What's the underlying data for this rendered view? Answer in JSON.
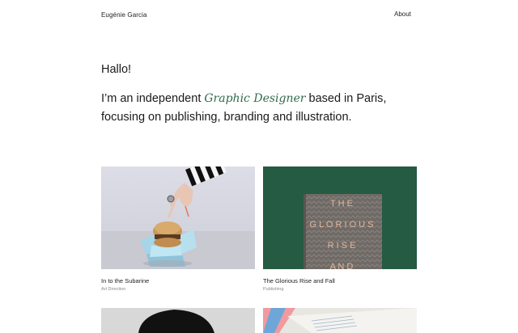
{
  "header": {
    "brand": "Eugénie Garcia",
    "nav": {
      "about": "About"
    }
  },
  "hero": {
    "greeting": "Hallo!",
    "intro_before": "I’m an independent ",
    "intro_accent": "Graphic Designer",
    "intro_after": " based in Paris, focusing on publishing, branding and illustration."
  },
  "projects": [
    {
      "title": "In to the Subarine",
      "category": "Art Direction"
    },
    {
      "title": "The Glorious Rise and Fall",
      "category": "Publishing"
    },
    {
      "title": "",
      "category": ""
    },
    {
      "title": "",
      "category": ""
    }
  ],
  "book_cover": {
    "lines": [
      "T H E",
      "G L O R I O U S",
      "R I S E",
      "A N D"
    ]
  },
  "colors": {
    "accent": "#2f6b4c",
    "book_green": "#255a43",
    "book_gray": "#7a7470",
    "book_text": "#e1b59a"
  }
}
